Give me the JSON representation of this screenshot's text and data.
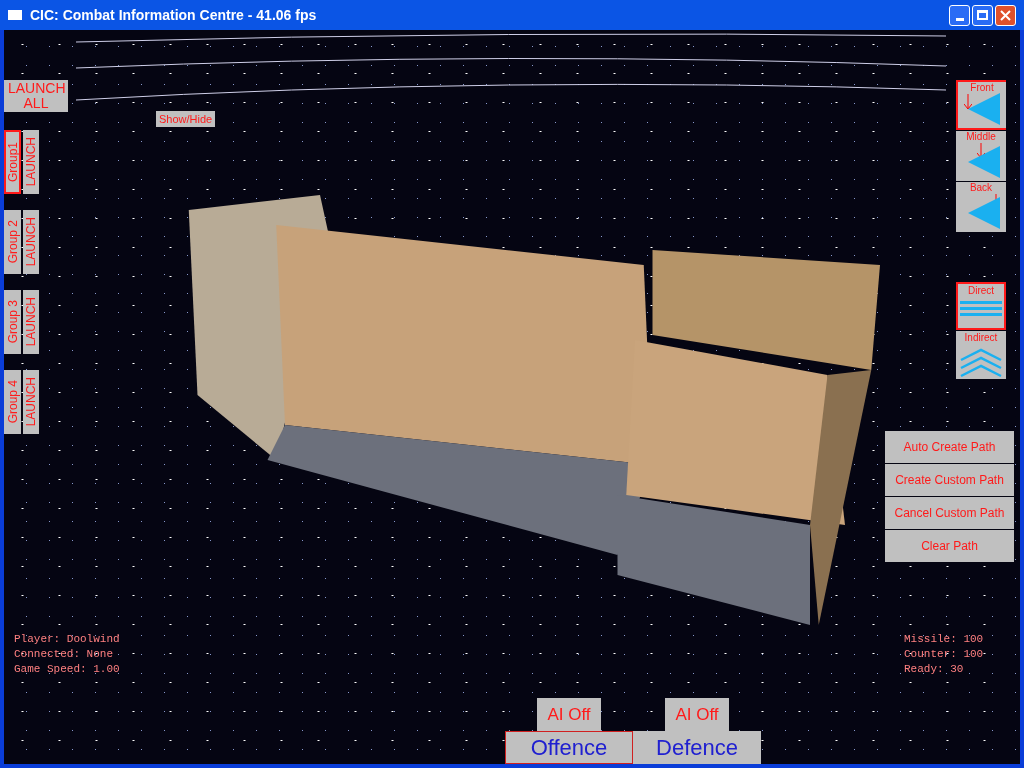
{
  "window": {
    "title": "CIC: Combat Information Centre - 41.06 fps"
  },
  "launch_all": "LAUNCH ALL",
  "show_hide": "Show/Hide",
  "groups": [
    {
      "label": "Group1",
      "launch": "LAUNCH",
      "selected": true
    },
    {
      "label": "Group 2",
      "launch": "LAUNCH",
      "selected": false
    },
    {
      "label": "Group 3",
      "launch": "LAUNCH",
      "selected": false
    },
    {
      "label": "Group 4",
      "launch": "LAUNCH",
      "selected": false
    }
  ],
  "formation": [
    {
      "label": "Front",
      "kind": "front",
      "selected": true
    },
    {
      "label": "Middle",
      "kind": "middle",
      "selected": false
    },
    {
      "label": "Back",
      "kind": "back",
      "selected": false
    }
  ],
  "attack_mode": [
    {
      "label": "Direct",
      "kind": "direct",
      "selected": true
    },
    {
      "label": "Indirect",
      "kind": "indirect",
      "selected": false
    }
  ],
  "path_buttons": [
    "Auto Create Path",
    "Create Custom Path",
    "Cancel Custom Path",
    "Clear Path"
  ],
  "player_info": [
    "Player: Doolwind",
    "Connected: None",
    "Game Speed: 1.00"
  ],
  "ammo_info": [
    "Missile: 100",
    "Counter: 100",
    "Ready: 30"
  ],
  "sides": [
    {
      "label": "Offence",
      "ai": "AI Off",
      "selected": true
    },
    {
      "label": "Defence",
      "ai": "AI Off",
      "selected": false
    }
  ]
}
